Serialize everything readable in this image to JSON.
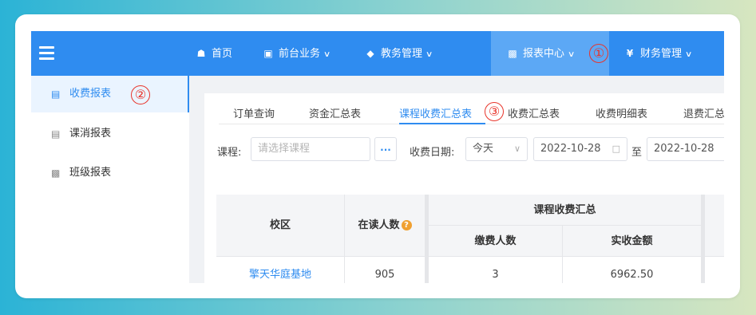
{
  "colors": {
    "primary": "#2f8cf0",
    "annotation": "#e8342a",
    "help": "#f0a030"
  },
  "topnav": {
    "menu_icon": "hamburger-icon",
    "items": [
      {
        "label": "首页",
        "icon": "home-icon"
      },
      {
        "label": "前台业务",
        "icon": "monitor-icon"
      },
      {
        "label": "教务管理",
        "icon": "graduation-cap-icon"
      },
      {
        "label": "报表中心",
        "icon": "bar-chart-icon"
      },
      {
        "label": "财务管理",
        "icon": "yen-icon"
      }
    ],
    "active": "报表中心"
  },
  "markers": [
    "①",
    "②",
    "③"
  ],
  "sidebar": {
    "items": [
      {
        "label": "收费报表",
        "icon": "receipt-icon"
      },
      {
        "label": "课消报表",
        "icon": "document-icon"
      },
      {
        "label": "班级报表",
        "icon": "bar-chart-icon"
      }
    ],
    "active": "收费报表"
  },
  "tabs": [
    "订单查询",
    "资金汇总表",
    "课程收费汇总表",
    "收费汇总表",
    "收费明细表",
    "退费汇总"
  ],
  "active_tab": "课程收费汇总表",
  "filters": {
    "course_label": "课程:",
    "course_placeholder": "请选择课程",
    "more_button": "...",
    "date_label": "收费日期:",
    "date_range_select": "今天",
    "start_date": "2022-10-28",
    "to_label": "至",
    "end_date": "2022-10-28"
  },
  "table": {
    "headers": {
      "campus": "校区",
      "enrolled": "在读人数",
      "group": "课程收费汇总",
      "payers": "缴费人数",
      "amount": "实收金额"
    },
    "rows": [
      {
        "campus": "擎天华庭基地",
        "enrolled": "905",
        "payers": "3",
        "amount": "6962.50"
      }
    ]
  }
}
